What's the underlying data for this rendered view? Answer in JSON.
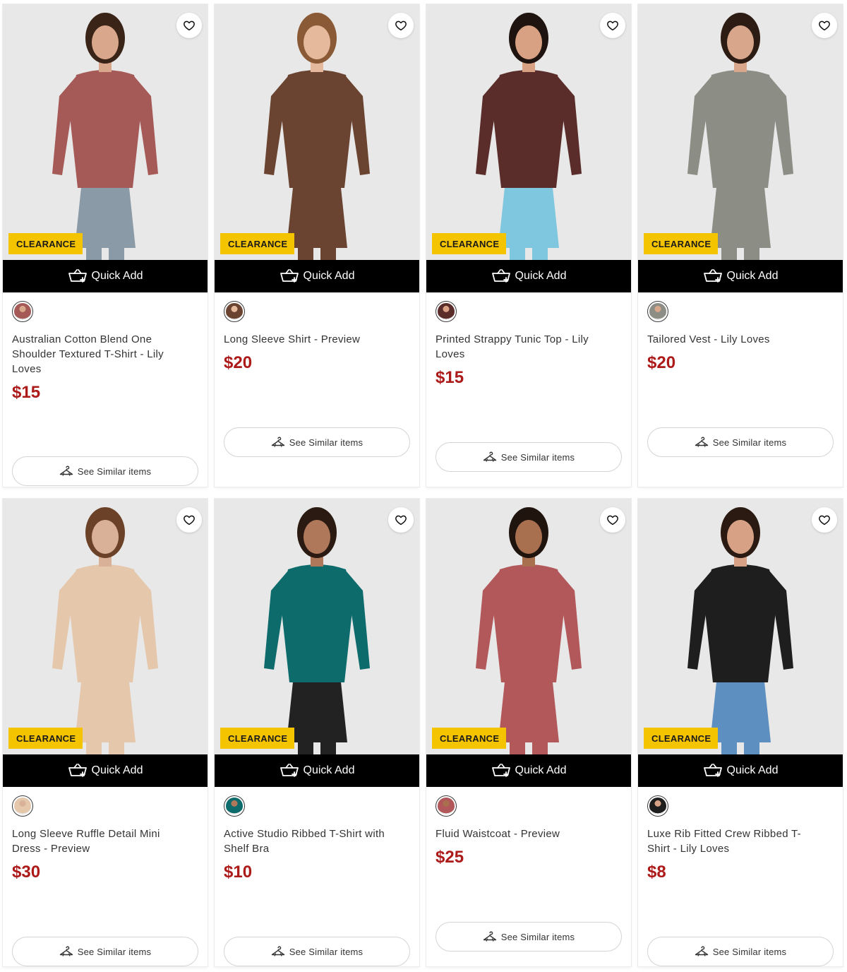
{
  "products": [
    {
      "badge": "CLEARANCE",
      "quick_add": "Quick Add",
      "name": "Australian Cotton Blend One Shoulder Textured T-Shirt - Lily Loves",
      "price": "$15",
      "similar": "See Similar items",
      "color": "#a55a57",
      "bottom": "#8a9aa6",
      "skin": "#d9a88c",
      "hair": "#3a2418"
    },
    {
      "badge": "CLEARANCE",
      "quick_add": "Quick Add",
      "name": "Long Sleeve Shirt - Preview",
      "price": "$20",
      "similar": "See Similar items",
      "color": "#6b4431",
      "bottom": "#6b4431",
      "skin": "#e4b99c",
      "hair": "#8a5a36"
    },
    {
      "badge": "CLEARANCE",
      "quick_add": "Quick Add",
      "name": "Printed Strappy Tunic Top - Lily Loves",
      "price": "$15",
      "similar": "See Similar items",
      "color": "#5a2c2a",
      "bottom": "#7fc6df",
      "skin": "#d8a183",
      "hair": "#1e130e"
    },
    {
      "badge": "CLEARANCE",
      "quick_add": "Quick Add",
      "name": "Tailored Vest - Lily Loves",
      "price": "$20",
      "similar": "See Similar items",
      "color": "#8c8e86",
      "bottom": "#8c8e86",
      "skin": "#d8a68a",
      "hair": "#2c1c14"
    },
    {
      "badge": "CLEARANCE",
      "quick_add": "Quick Add",
      "name": "Long Sleeve Ruffle Detail Mini Dress - Preview",
      "price": "$30",
      "similar": "See Similar items",
      "color": "#e5c7ab",
      "bottom": "#e5c7ab",
      "skin": "#d9b198",
      "hair": "#6b4228"
    },
    {
      "badge": "CLEARANCE",
      "quick_add": "Quick Add",
      "name": "Active Studio Ribbed T-Shirt with Shelf Bra",
      "price": "$10",
      "similar": "See Similar items",
      "color": "#0e6b6c",
      "bottom": "#222222",
      "skin": "#b0785a",
      "hair": "#2a1a12"
    },
    {
      "badge": "CLEARANCE",
      "quick_add": "Quick Add",
      "name": "Fluid Waistcoat - Preview",
      "price": "$25",
      "similar": "See Similar items",
      "color": "#b2585a",
      "bottom": "#b2585a",
      "skin": "#a8704f",
      "hair": "#20140e"
    },
    {
      "badge": "CLEARANCE",
      "quick_add": "Quick Add",
      "name": "Luxe Rib Fitted Crew Ribbed T-Shirt - Lily Loves",
      "price": "$8",
      "similar": "See Similar items",
      "color": "#1e1e1e",
      "bottom": "#5d8fc0",
      "skin": "#d6a184",
      "hair": "#2a1a12"
    }
  ]
}
